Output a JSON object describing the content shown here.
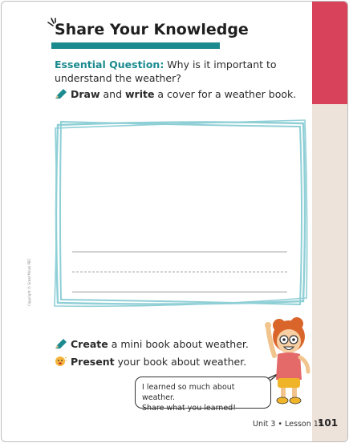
{
  "header": {
    "title": "Share Your Knowledge"
  },
  "essential_question": {
    "label": "Essential Question:",
    "text": " Why is it important to understand the weather?"
  },
  "instructions": [
    {
      "icon": "pencil-icon",
      "verb1": "Draw",
      "mid": " and ",
      "verb2": "write",
      "rest": " a cover for a weather book."
    },
    {
      "icon": "pencil-icon",
      "verb1": "Create",
      "rest": " a mini book about weather."
    },
    {
      "icon": "speaking-face-icon",
      "verb1": "Present",
      "rest": " your book about weather."
    }
  ],
  "speech_bubble": {
    "line1": "I learned so much about weather.",
    "line2": "Share what you learned!"
  },
  "copyright": "Copyright © Great Minds PBC",
  "footer": {
    "lesson": "Unit 3 • Lesson 15",
    "page_number": "101"
  },
  "colors": {
    "accent_teal": "#1b8b8f",
    "side_red": "#d8435b",
    "side_cream": "#eee3db",
    "frame_blue": "#8fcfd6"
  }
}
